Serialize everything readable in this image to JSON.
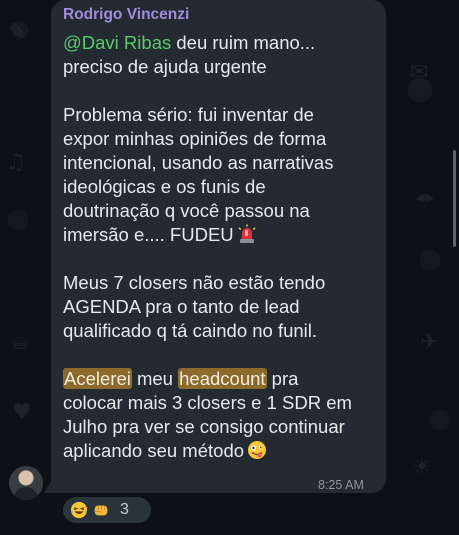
{
  "message": {
    "sender": "Rodrigo Vincenzi",
    "mention": "@Davi Ribas",
    "lines": {
      "l1_rest": " deu ruim mano...",
      "l2": "preciso de ajuda urgente",
      "l3": "Problema sério: fui inventar de",
      "l4": "expor minhas opiniões de forma",
      "l5": "intencional, usando as narrativas",
      "l6": "ideológicas e os funis de",
      "l7": "doutrinação q você passou na",
      "l8": "imersão e.... FUDEU",
      "l9": "Meus 7 closers não  estão tendo",
      "l10": "AGENDA pra o tanto de lead",
      "l11": "qualificado q tá caindo no funil.",
      "l12_hl1": "Acelerei",
      "l12_mid": " meu ",
      "l12_hl2": "headcount",
      "l12_end": " pra",
      "l13": "colocar mais 3 closers e 1 SDR em",
      "l14": "Julho pra ver se consigo continuar",
      "l15": "aplicando seu método"
    },
    "timestamp": "8:25 AM",
    "emoji_siren": "siren-emoji",
    "emoji_zany": "zany-face-emoji"
  },
  "reactions": {
    "items": [
      "laughing-tears-emoji",
      "fist-emoji"
    ],
    "count": "3"
  },
  "colors": {
    "bubble": "#232a31",
    "sender": "#a28ddd",
    "mention": "#5cc96b",
    "highlight": "#8c6a2b",
    "text": "#e7e9ea"
  }
}
